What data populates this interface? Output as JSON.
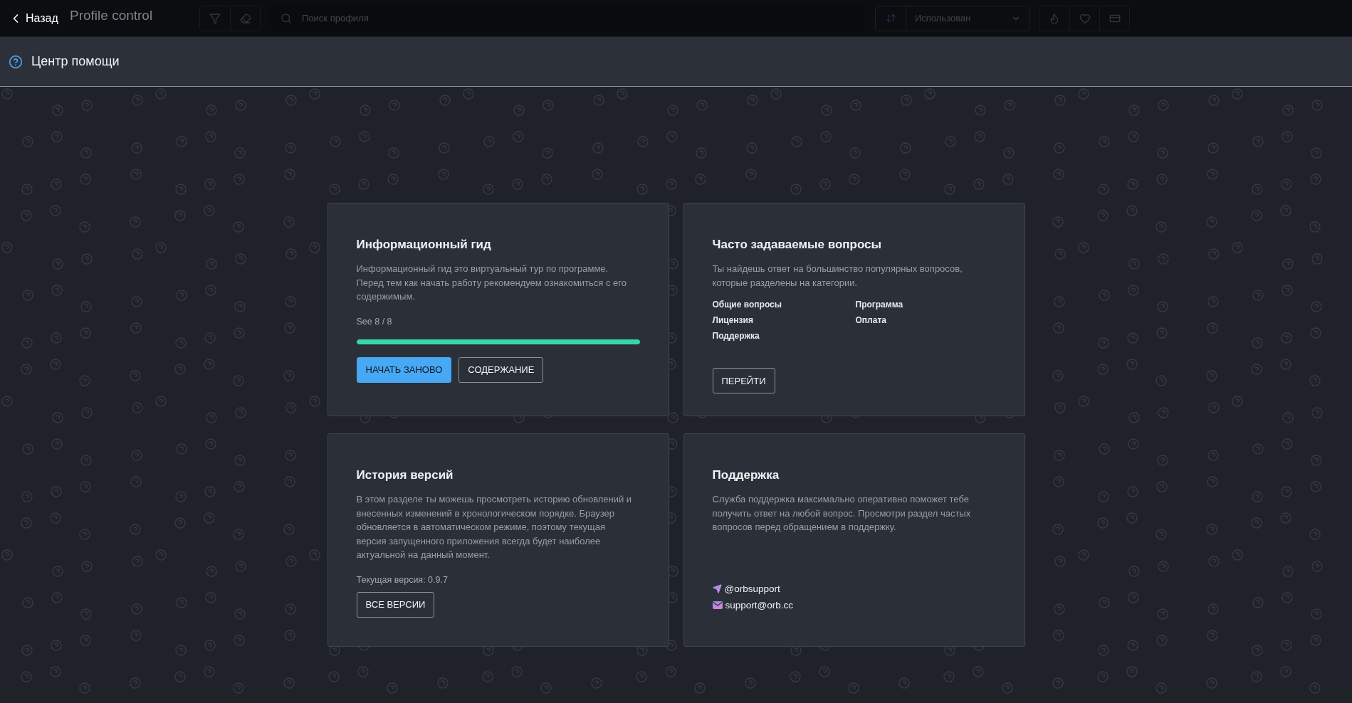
{
  "top_bar": {
    "back_label": "Назад",
    "app_title": "Profile control",
    "search": {
      "placeholder": "Поиск профиля"
    },
    "sort_select": {
      "value": "Использован"
    }
  },
  "header": {
    "title": "Центр помощи"
  },
  "cards": [
    {
      "kind": "guide",
      "title": "Информационный гид",
      "description": "Информационный гид это виртуальный тур по программе. Перед тем как начать работу рекомендуем ознакомиться с его содержимым.",
      "progress_label": "See 8 / 8",
      "progress": {
        "level": 1
      },
      "buttons": [
        {
          "label": "НАЧАТЬ ЗАНОВО",
          "primary": true
        },
        {
          "label": "СОДЕРЖАНИЕ",
          "primary": false
        }
      ]
    },
    {
      "kind": "faq",
      "title": "Часто задаваемые вопросы",
      "description": "Ты найдешь ответ на большинство популярных вопросов, которые разделены на категории.",
      "categories": [
        "Общие вопросы",
        "Программа",
        "Лицензия",
        "Оплата",
        "Поддержка"
      ],
      "buttons": [
        {
          "label": "ПЕРЕЙТИ",
          "primary": false
        }
      ]
    },
    {
      "kind": "versions",
      "title": "История версий",
      "description": "В этом разделе ты можешь просмотреть историю обновлений и внесенных изменений в хронологическом порядке. Браузер обновляется в автоматическом режиме, поэтому текущая версия запущенного приложения всегда будет наиболее актуальной на данный момент.",
      "current_version": "Текущая версия: 0.9.7",
      "buttons": [
        {
          "label": "ВСЕ ВЕРСИИ",
          "primary": false
        }
      ]
    },
    {
      "kind": "support",
      "title": "Поддержка",
      "description": "Служба поддержка максимально оперативно поможет тебе получить ответ на любой вопрос. Просмотри раздел частых вопросов перед обращением в поддержку.",
      "contacts": [
        {
          "kind": "telegram",
          "label": "@orbsupport"
        },
        {
          "kind": "email",
          "label": "support@orb.cc"
        }
      ]
    }
  ]
}
